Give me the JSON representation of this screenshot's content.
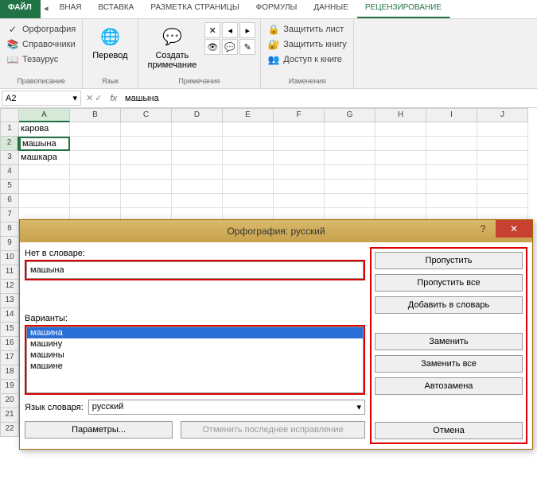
{
  "tabs": {
    "file": "ФАЙЛ",
    "items": [
      "ВНАЯ",
      "ВСТАВКА",
      "РАЗМЕТКА СТРАНИЦЫ",
      "ФОРМУЛЫ",
      "ДАННЫЕ",
      "РЕЦЕНЗИРОВАНИЕ"
    ],
    "active_index": 5
  },
  "ribbon": {
    "proofing": {
      "spell": "Орфография",
      "research": "Справочники",
      "thesaurus": "Тезаурус",
      "label": "Правописание"
    },
    "language": {
      "translate": "Перевод",
      "label": "Язык"
    },
    "comments": {
      "new": "Создать\nпримечание",
      "label": "Примечания"
    },
    "changes": {
      "protect_sheet": "Защитить лист",
      "protect_book": "Защитить книгу",
      "share_book": "Доступ к книге",
      "label": "Изменения"
    }
  },
  "namebox": "A2",
  "formula": "машына",
  "columns": [
    "A",
    "B",
    "C",
    "D",
    "E",
    "F",
    "G",
    "H",
    "I",
    "J"
  ],
  "rows_visible": 22,
  "cells": {
    "A1": "карова",
    "A2": "машына",
    "A3": "машкара"
  },
  "active_cell": "A2",
  "dialog": {
    "title": "Орфография: русский",
    "not_in_dict_label": "Нет в словаре:",
    "not_in_dict_value": "машына",
    "suggestions_label": "Варианты:",
    "suggestions": [
      "машина",
      "машину",
      "машины",
      "машине"
    ],
    "suggestion_selected": 0,
    "lang_label": "Язык словаря:",
    "lang_value": "русский",
    "options": "Параметры...",
    "undo_last": "Отменить последнее исправление",
    "buttons": {
      "skip": "Пропустить",
      "skip_all": "Пропустить все",
      "add": "Добавить в словарь",
      "change": "Заменить",
      "change_all": "Заменить все",
      "autocorrect": "Автозамена",
      "cancel": "Отмена"
    }
  }
}
